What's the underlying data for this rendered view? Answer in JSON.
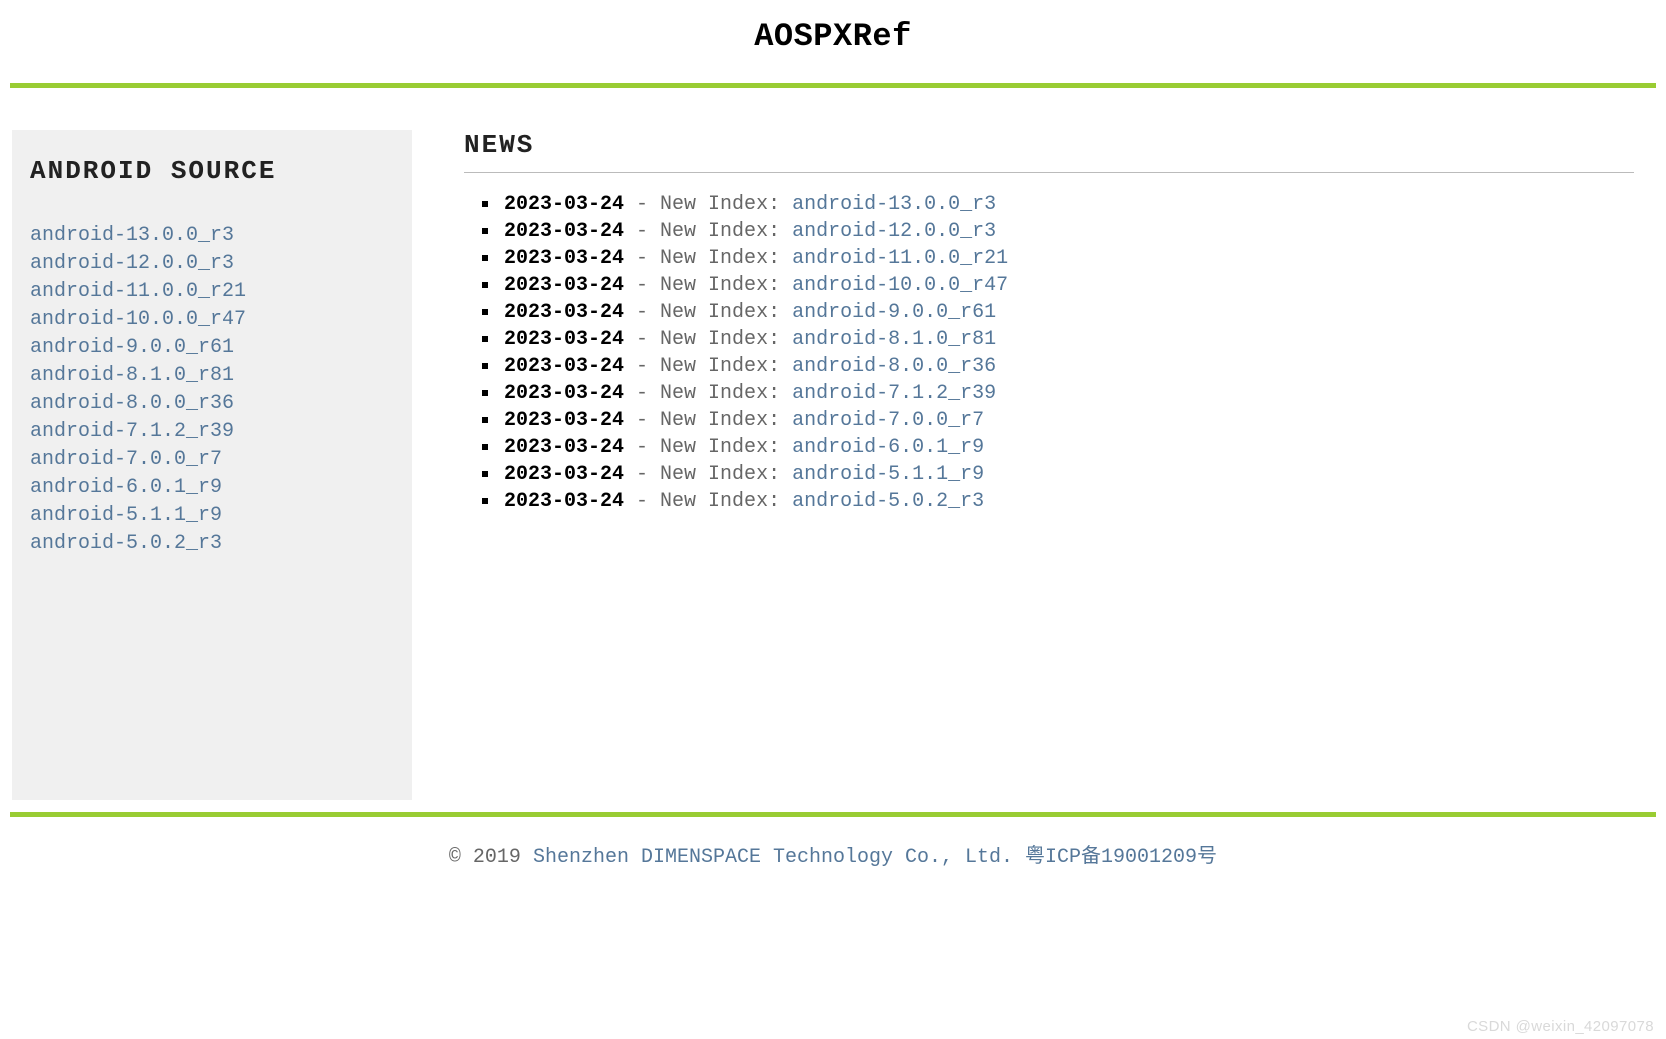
{
  "header": {
    "title": "AOSPXRef"
  },
  "sidebar": {
    "heading": "ANDROID SOURCE",
    "items": [
      "android-13.0.0_r3",
      "android-12.0.0_r3",
      "android-11.0.0_r21",
      "android-10.0.0_r47",
      "android-9.0.0_r61",
      "android-8.1.0_r81",
      "android-8.0.0_r36",
      "android-7.1.2_r39",
      "android-7.0.0_r7",
      "android-6.0.1_r9",
      "android-5.1.1_r9",
      "android-5.0.2_r3"
    ]
  },
  "news": {
    "heading": "NEWS",
    "items": [
      {
        "date": "2023-03-24",
        "desc": "New Index:",
        "link": "android-13.0.0_r3"
      },
      {
        "date": "2023-03-24",
        "desc": "New Index:",
        "link": "android-12.0.0_r3"
      },
      {
        "date": "2023-03-24",
        "desc": "New Index:",
        "link": "android-11.0.0_r21"
      },
      {
        "date": "2023-03-24",
        "desc": "New Index:",
        "link": "android-10.0.0_r47"
      },
      {
        "date": "2023-03-24",
        "desc": "New Index:",
        "link": "android-9.0.0_r61"
      },
      {
        "date": "2023-03-24",
        "desc": "New Index:",
        "link": "android-8.1.0_r81"
      },
      {
        "date": "2023-03-24",
        "desc": "New Index:",
        "link": "android-8.0.0_r36"
      },
      {
        "date": "2023-03-24",
        "desc": "New Index:",
        "link": "android-7.1.2_r39"
      },
      {
        "date": "2023-03-24",
        "desc": "New Index:",
        "link": "android-7.0.0_r7"
      },
      {
        "date": "2023-03-24",
        "desc": "New Index:",
        "link": "android-6.0.1_r9"
      },
      {
        "date": "2023-03-24",
        "desc": "New Index:",
        "link": "android-5.1.1_r9"
      },
      {
        "date": "2023-03-24",
        "desc": "New Index:",
        "link": "android-5.0.2_r3"
      }
    ]
  },
  "footer": {
    "copyright_prefix": "© 2019 ",
    "company_link": "Shenzhen DIMENSPACE Technology Co., Ltd.",
    "icp_link": "粤ICP备19001209号"
  },
  "watermark": "CSDN @weixin_42097078"
}
